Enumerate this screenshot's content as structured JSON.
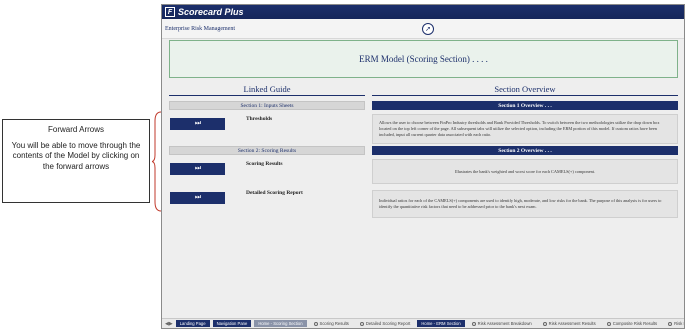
{
  "callout": {
    "title": "Forward Arrows",
    "body": "You will be able to move through the contents of the Model by clicking on the forward arrows"
  },
  "app": {
    "logo_letter": "F",
    "name": "Scorecard Plus",
    "breadcrumb": "Enterprise Risk Management",
    "page_title": "ERM Model (Scoring Section) . . . ."
  },
  "linked_guide": {
    "heading": "Linked Guide",
    "sections": [
      {
        "label": "Section 1: Inputs Sheets",
        "items": [
          {
            "button": "⏭",
            "label": "Thresholds"
          }
        ]
      },
      {
        "label": "Section 2: Scoring Results",
        "items": [
          {
            "button": "⏭",
            "label": "Scoring Results"
          },
          {
            "button": "⏭",
            "label": "Detailed Scoring Report"
          }
        ]
      }
    ]
  },
  "overview": {
    "heading": "Section Overview",
    "sections": [
      {
        "label": "Section 1 Overview . . .",
        "descriptions": [
          "Allows the user to choose between FinPro Industry thresholds and Bank Provided Thresholds. To switch between the two methodologies utilize the drop down box located on the top left corner of the page. All subsequent tabs will utilize the selected option, including the ERM portion of this model. If custom ratios have been included, input all current quarter data associated with each ratio."
        ]
      },
      {
        "label": "Section 2 Overview . . .",
        "descriptions": [
          "Illustrates the bank's weighted and worst score for each CAMELS(+) component.",
          "Individual ratios for each of the CAMELS(+) components are used to identify high, moderate, and low risks for the bank. The purpose of this analysis is for users to identify the quantitative risk factors that need to be addressed prior to the bank's next exam."
        ]
      }
    ]
  },
  "tabs": [
    {
      "label": "Landing Page",
      "style": "dark"
    },
    {
      "label": "Navigation Pane",
      "style": "dark"
    },
    {
      "label": "Home - Scoring Section",
      "style": "sel"
    },
    {
      "label": "Scoring Results",
      "style": "plain"
    },
    {
      "label": "Detailed Scoring Report",
      "style": "plain"
    },
    {
      "label": "Home - ERM Section",
      "style": "dark"
    },
    {
      "label": "Risk Assessment Breakdown",
      "style": "plain"
    },
    {
      "label": "Risk Assessment Results",
      "style": "plain"
    },
    {
      "label": "Composite Risk Results",
      "style": "plain"
    },
    {
      "label": "Risk Factor Detail",
      "style": "plain"
    }
  ],
  "icons": {
    "compass": "compass-icon",
    "forward": "fast-forward-icon",
    "tab_nav_prev": "chevron-left-icon",
    "tab_nav_next": "chevron-right-icon"
  },
  "colors": {
    "brand_navy": "#1c2f6b",
    "title_box_border": "#7fb28a",
    "title_box_fill": "#eaf2ec"
  }
}
